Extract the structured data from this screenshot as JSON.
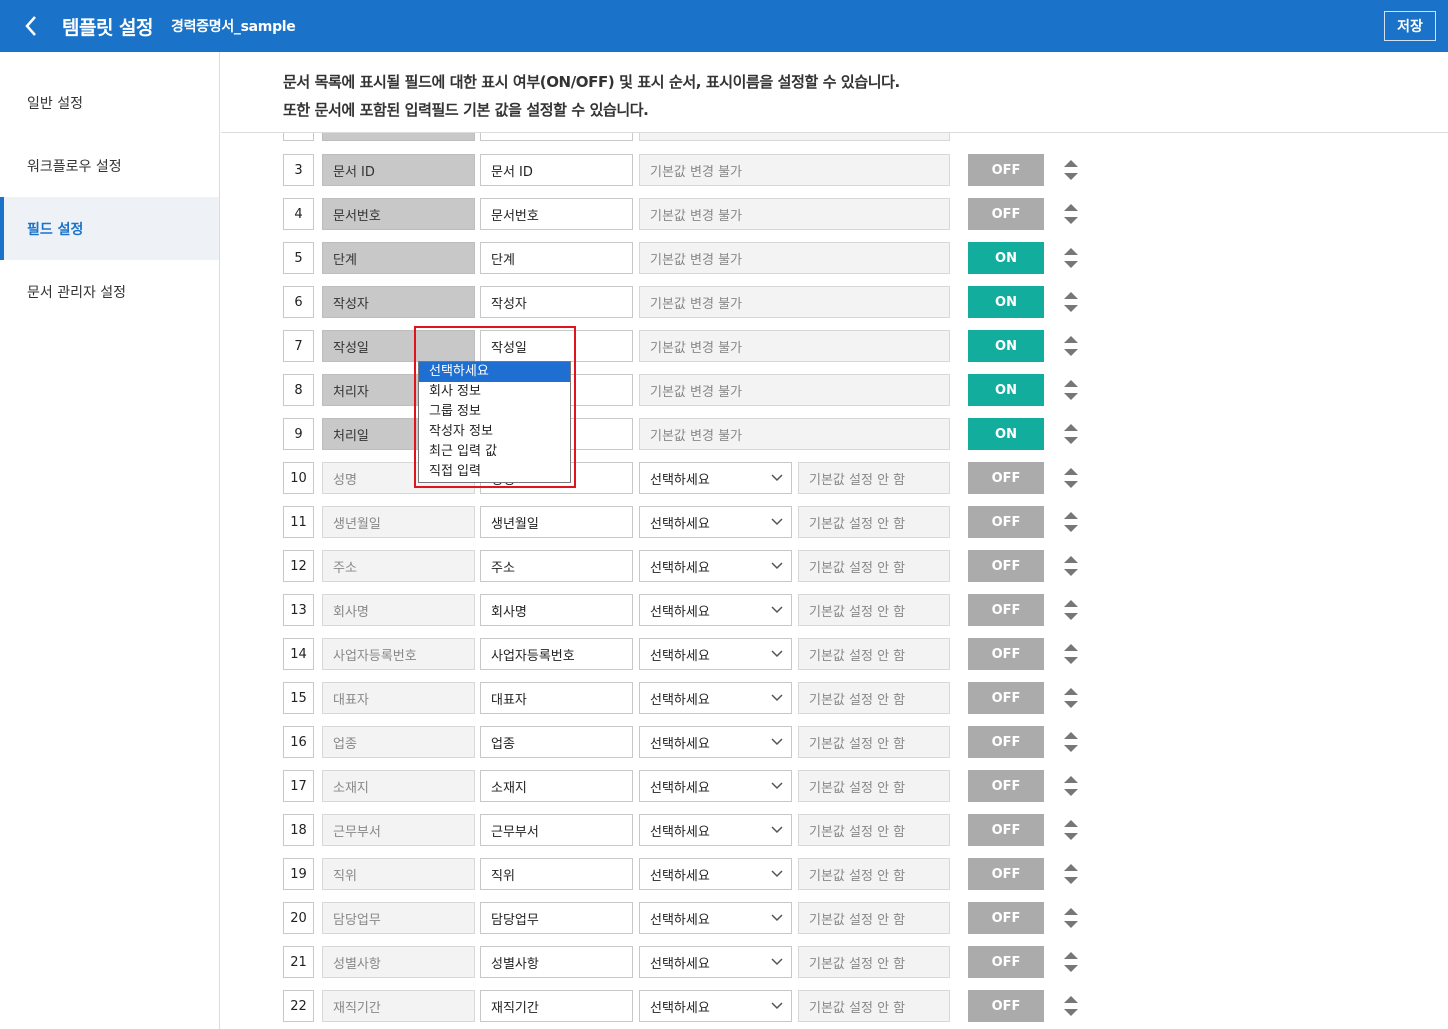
{
  "header": {
    "title": "템플릿 설정",
    "subtitle": "경력증명서_sample",
    "save_label": "저장",
    "back_icon": "chevron-left-icon",
    "color": "#1a73c8"
  },
  "sidebar": {
    "items": [
      {
        "label": "일반 설정",
        "active": false
      },
      {
        "label": "워크플로우 설정",
        "active": false
      },
      {
        "label": "필드 설정",
        "active": true
      },
      {
        "label": "문서 관리자 설정",
        "active": false
      }
    ]
  },
  "description": {
    "line1": "문서 목록에 표시될 필드에 대한 표시 여부(ON/OFF) 및 표시 순서, 표시이름을 설정할 수 있습니다.",
    "line2": "또한 문서에 포함된 입력필드 기본 값을 설정할 수 있습니다."
  },
  "fields": [
    {
      "num": "3",
      "original": "문서 ID",
      "display": "문서 ID",
      "fixed": "기본값 변경 불가",
      "status": "OFF",
      "system": true
    },
    {
      "num": "4",
      "original": "문서번호",
      "display": "문서번호",
      "fixed": "기본값 변경 불가",
      "status": "OFF",
      "system": true
    },
    {
      "num": "5",
      "original": "단계",
      "display": "단계",
      "fixed": "기본값 변경 불가",
      "status": "ON",
      "system": true
    },
    {
      "num": "6",
      "original": "작성자",
      "display": "작성자",
      "fixed": "기본값 변경 불가",
      "status": "ON",
      "system": true
    },
    {
      "num": "7",
      "original": "작성일",
      "display": "작성일",
      "fixed": "기본값 변경 불가",
      "status": "ON",
      "system": true
    },
    {
      "num": "8",
      "original": "처리자",
      "display": "처리자",
      "fixed": "기본값 변경 불가",
      "status": "ON",
      "system": true
    },
    {
      "num": "9",
      "original": "처리일",
      "display": "처리일",
      "fixed": "기본값 변경 불가",
      "status": "ON",
      "system": true
    },
    {
      "num": "10",
      "original": "성명",
      "display": "성명",
      "select": "선택하세요",
      "default": "기본값 설정 안 함",
      "status": "OFF",
      "system": false
    },
    {
      "num": "11",
      "original": "생년월일",
      "display": "생년월일",
      "select": "선택하세요",
      "default": "기본값 설정 안 함",
      "status": "OFF",
      "system": false
    },
    {
      "num": "12",
      "original": "주소",
      "display": "주소",
      "select": "선택하세요",
      "default": "기본값 설정 안 함",
      "status": "OFF",
      "system": false
    },
    {
      "num": "13",
      "original": "회사명",
      "display": "회사명",
      "select": "선택하세요",
      "default": "기본값 설정 안 함",
      "status": "OFF",
      "system": false
    },
    {
      "num": "14",
      "original": "사업자등록번호",
      "display": "사업자등록번호",
      "select": "선택하세요",
      "default": "기본값 설정 안 함",
      "status": "OFF",
      "system": false
    },
    {
      "num": "15",
      "original": "대표자",
      "display": "대표자",
      "select": "선택하세요",
      "default": "기본값 설정 안 함",
      "status": "OFF",
      "system": false
    },
    {
      "num": "16",
      "original": "업종",
      "display": "업종",
      "select": "선택하세요",
      "default": "기본값 설정 안 함",
      "status": "OFF",
      "system": false
    },
    {
      "num": "17",
      "original": "소재지",
      "display": "소재지",
      "select": "선택하세요",
      "default": "기본값 설정 안 함",
      "status": "OFF",
      "system": false
    },
    {
      "num": "18",
      "original": "근무부서",
      "display": "근무부서",
      "select": "선택하세요",
      "default": "기본값 설정 안 함",
      "status": "OFF",
      "system": false
    },
    {
      "num": "19",
      "original": "직위",
      "display": "직위",
      "select": "선택하세요",
      "default": "기본값 설정 안 함",
      "status": "OFF",
      "system": false
    },
    {
      "num": "20",
      "original": "담당업무",
      "display": "담당업무",
      "select": "선택하세요",
      "default": "기본값 설정 안 함",
      "status": "OFF",
      "system": false
    },
    {
      "num": "21",
      "original": "성별사항",
      "display": "성별사항",
      "select": "선택하세요",
      "default": "기본값 설정 안 함",
      "status": "OFF",
      "system": false
    },
    {
      "num": "22",
      "original": "재직기간",
      "display": "재직기간",
      "select": "선택하세요",
      "default": "기본값 설정 안 함",
      "status": "OFF",
      "system": false
    }
  ],
  "dropdown": {
    "options": [
      "선택하세요",
      "회사 정보",
      "그룹 정보",
      "작성자 정보",
      "최근 입력 값",
      "직접 입력"
    ],
    "selected_index": 0
  },
  "colors": {
    "on": "#13ad9e",
    "off": "#ababab",
    "highlight": "#e0141e"
  },
  "icons": {
    "sort": "arrows-icon",
    "dropdown": "chevron-down-icon"
  }
}
